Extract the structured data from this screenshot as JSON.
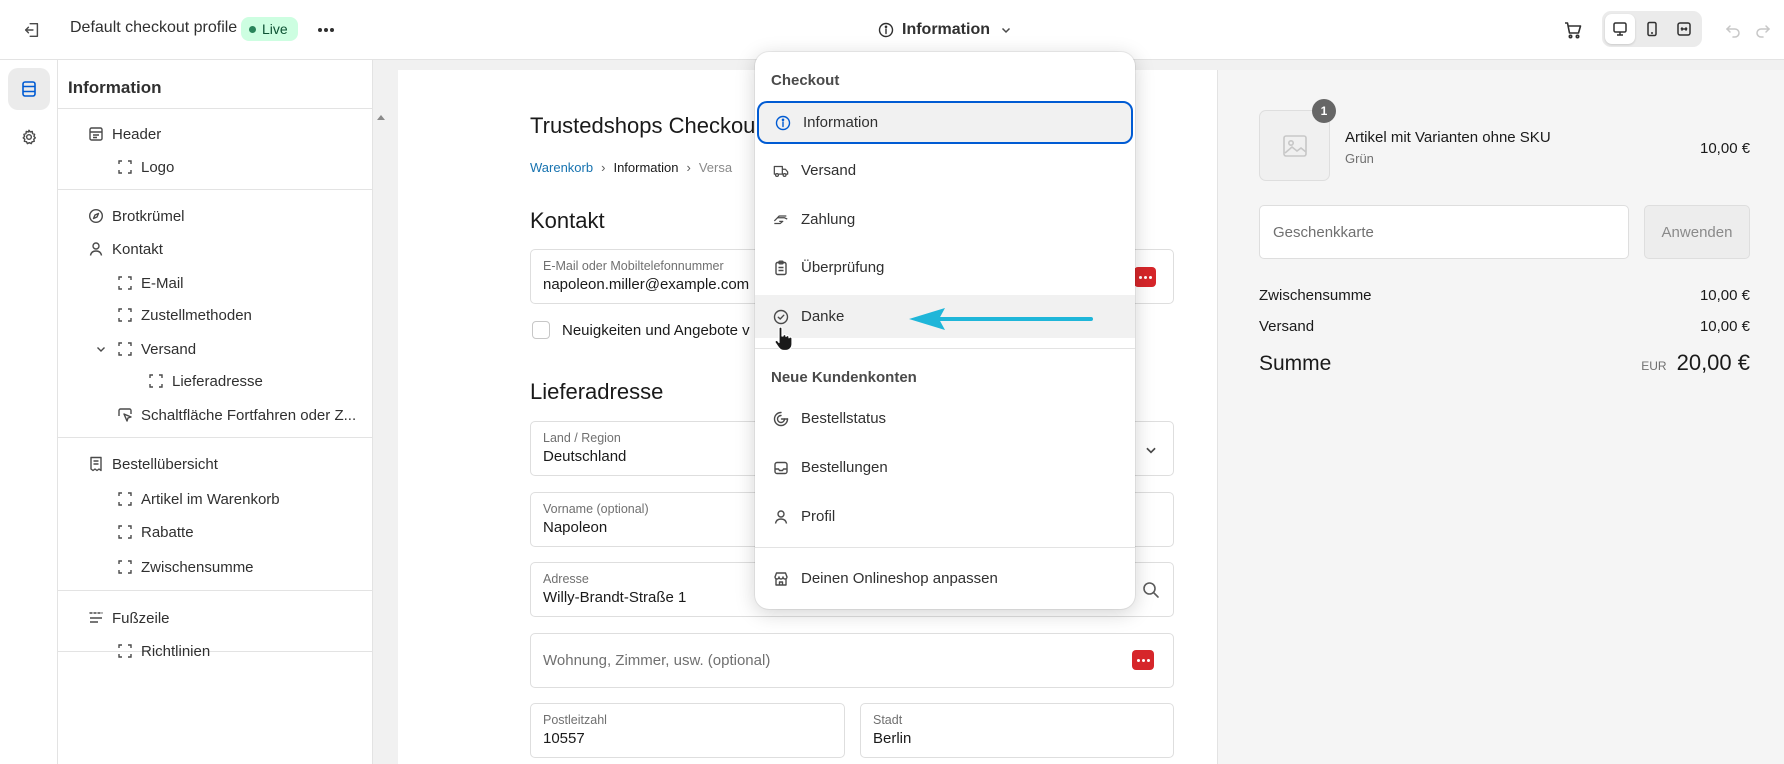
{
  "topbar": {
    "profile_title": "Default checkout profile",
    "live_badge": "Live",
    "page_selector": "Information"
  },
  "sidebar": {
    "title": "Information",
    "items": [
      {
        "label": "Header",
        "icon": "header-icon"
      },
      {
        "label": "Logo",
        "icon": "block-icon"
      },
      {
        "label": "Brotkrümel",
        "icon": "compass-icon"
      },
      {
        "label": "Kontakt",
        "icon": "person-icon"
      },
      {
        "label": "E-Mail",
        "icon": "block-icon"
      },
      {
        "label": "Zustellmethoden",
        "icon": "block-icon"
      },
      {
        "label": "Versand",
        "icon": "block-icon"
      },
      {
        "label": "Lieferadresse",
        "icon": "block-icon"
      },
      {
        "label": "Schaltfläche Fortfahren oder Z...",
        "icon": "cursor-block-icon"
      },
      {
        "label": "Bestellübersicht",
        "icon": "receipt-icon"
      },
      {
        "label": "Artikel im Warenkorb",
        "icon": "block-icon"
      },
      {
        "label": "Rabatte",
        "icon": "block-icon"
      },
      {
        "label": "Zwischensumme",
        "icon": "block-icon"
      },
      {
        "label": "Fußzeile",
        "icon": "footer-icon"
      },
      {
        "label": "Richtlinien",
        "icon": "block-icon"
      }
    ]
  },
  "preview": {
    "shop_title": "Trustedshops Checkou",
    "breadcrumb": [
      "Warenkorb",
      "Information",
      "Versa"
    ],
    "contact_heading": "Kontakt",
    "email_label": "E-Mail oder Mobiltelefonnummer",
    "email_value": "napoleon.miller@example.com",
    "newsletter_label": "Neuigkeiten und Angebote v",
    "shipping_heading": "Lieferadresse",
    "country_label": "Land / Region",
    "country_value": "Deutschland",
    "firstname_label": "Vorname (optional)",
    "firstname_value": "Napoleon",
    "address_label": "Adresse",
    "address_value": "Willy-Brandt-Straße 1",
    "apartment_placeholder": "Wohnung, Zimmer, usw. (optional)",
    "zip_label": "Postleitzahl",
    "zip_value": "10557",
    "city_label": "Stadt",
    "city_value": "Berlin"
  },
  "summary": {
    "qty": "1",
    "product_name": "Artikel mit Varianten ohne SKU",
    "product_variant": "Grün",
    "product_price": "10,00 €",
    "giftcard_placeholder": "Geschenkkarte",
    "apply_label": "Anwenden",
    "subtotal_label": "Zwischensumme",
    "subtotal_value": "10,00 €",
    "shipping_label": "Versand",
    "shipping_value": "10,00 €",
    "total_label": "Summe",
    "total_currency": "EUR",
    "total_value": "20,00 €"
  },
  "dropdown": {
    "group_checkout": "Checkout",
    "checkout_items": [
      {
        "label": "Information",
        "icon": "info-icon",
        "state": "selected"
      },
      {
        "label": "Versand",
        "icon": "truck-icon"
      },
      {
        "label": "Zahlung",
        "icon": "payment-icon"
      },
      {
        "label": "Überprüfung",
        "icon": "clipboard-icon"
      },
      {
        "label": "Danke",
        "icon": "check-circle-icon",
        "state": "hover"
      }
    ],
    "group_accounts": "Neue Kundenkonten",
    "account_items": [
      {
        "label": "Bestellstatus",
        "icon": "order-status-icon"
      },
      {
        "label": "Bestellungen",
        "icon": "inbox-icon"
      },
      {
        "label": "Profil",
        "icon": "person-icon"
      }
    ],
    "footer_item": {
      "label": "Deinen Onlineshop anpassen",
      "icon": "store-icon"
    }
  },
  "colors": {
    "accent_blue": "#005bd3",
    "annotation_arrow": "#1fb6d9",
    "live_badge_bg": "#cdfee1",
    "link": "#1773b0",
    "password_manager": "#d6262a"
  }
}
